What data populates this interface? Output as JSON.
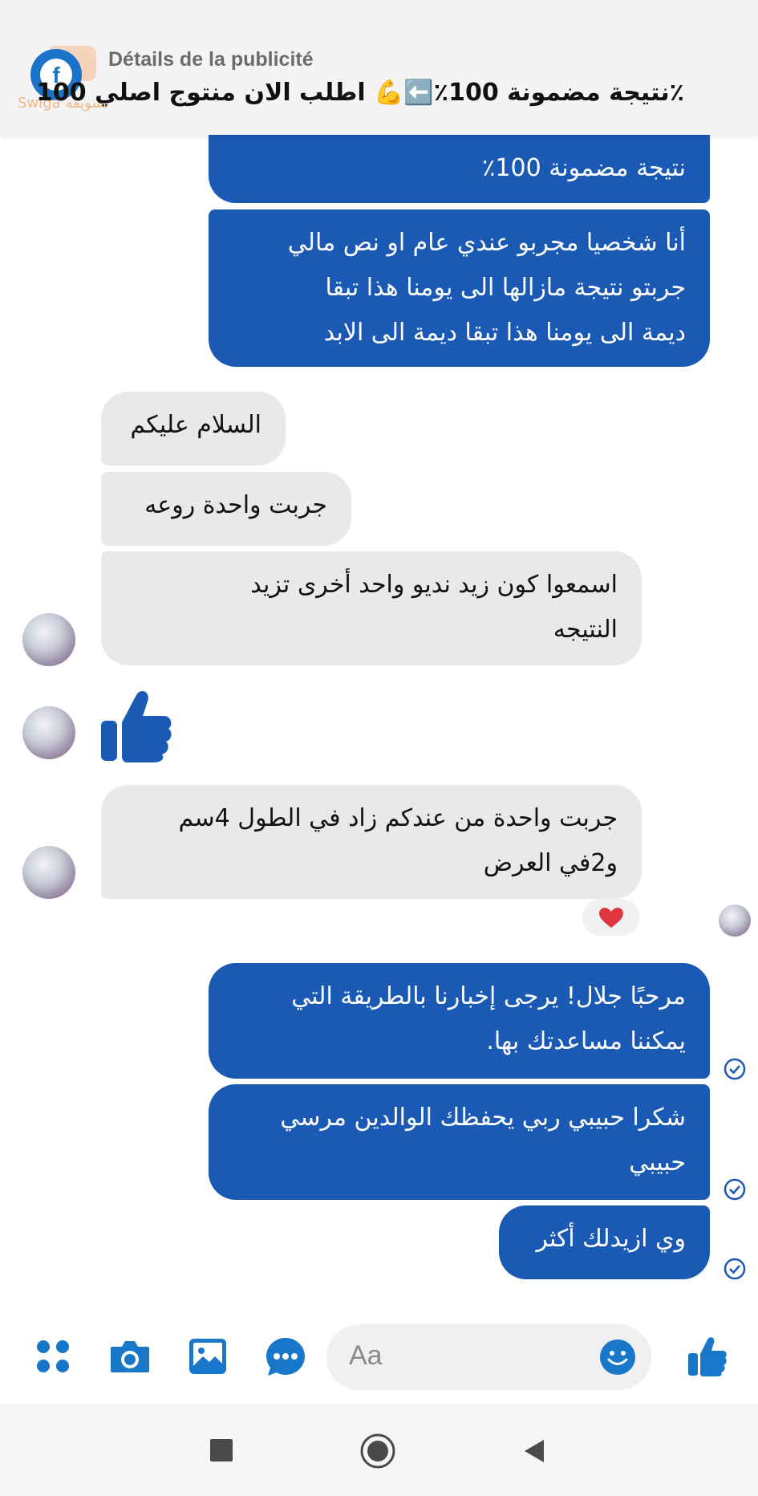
{
  "ad_header": {
    "title": "Détails de la publicité",
    "text": "٪نتيجة مضمونة 100٪⬅️💪 اطلب الان منتوج اصلي 100",
    "watermark": "Swiga تسويقة"
  },
  "messages": [
    {
      "id": "m1",
      "side": "outgoing",
      "text": "نتيجة مضمونة 100٪"
    },
    {
      "id": "m2",
      "side": "outgoing",
      "lines": [
        "أنا شخصيا مجربو عندي عام او نص مالي",
        "جربتو نتيجة مازالها الى يومنا هذا تبقا",
        "ديمة الى يومنا هذا تبقا ديمة الى الابد"
      ]
    },
    {
      "id": "m3",
      "side": "incoming",
      "text": "السلام عليكم"
    },
    {
      "id": "m4",
      "side": "incoming",
      "text": "جربت واحدة روعه"
    },
    {
      "id": "m5",
      "side": "incoming",
      "lines": [
        "اسمعوا كون زيد نديو  واحد أخرى تزيد",
        "النتيجه"
      ]
    },
    {
      "id": "m6",
      "side": "incoming",
      "type": "like-sticker"
    },
    {
      "id": "m7",
      "side": "incoming",
      "lines": [
        "جربت واحدة من عندكم زاد في الطول 4سم",
        "و2في العرض"
      ],
      "reaction": "heart"
    },
    {
      "id": "m8",
      "side": "outgoing",
      "lines": [
        "مرحبًا جلال! يرجى إخبارنا بالطريقة التي",
        "يمكننا مساعدتك بها."
      ],
      "status": "delivered"
    },
    {
      "id": "m9",
      "side": "outgoing",
      "lines": [
        "شكرا حبيبي ربي يحفظك الوالدين مرسي",
        "حبيبي"
      ],
      "status": "delivered"
    },
    {
      "id": "m10",
      "side": "outgoing",
      "text": "وي ازيدلك أكثر",
      "status": "delivered"
    }
  ],
  "composer": {
    "placeholder": "Aa"
  },
  "colors": {
    "outgoing": "#1b5ab4",
    "incoming": "#e9e9eb",
    "icon": "#1877c9",
    "heart": "#e0353f"
  },
  "icons": {
    "toolbar": [
      "apps-icon",
      "camera-icon",
      "gallery-icon",
      "voice-chat-icon",
      "emoji-icon",
      "like-icon"
    ],
    "navigation": [
      "recent-apps-icon",
      "home-icon",
      "back-icon"
    ]
  }
}
